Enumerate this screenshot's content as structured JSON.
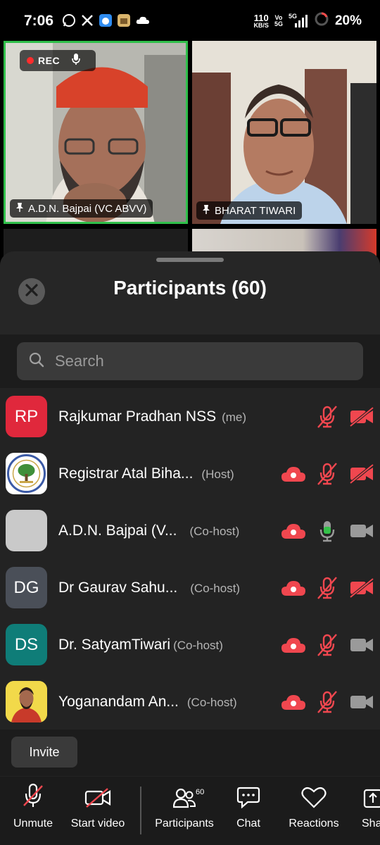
{
  "status_bar": {
    "time": "7:06",
    "net_speed_top": "110",
    "net_speed_bottom": "KB/S",
    "volte_top": "Vo",
    "volte_bottom": "5G",
    "network": "5G",
    "battery": "20%"
  },
  "video_tiles": [
    {
      "name": "A.D.N. Bajpai (VC ABVV)",
      "active_speaker": true
    },
    {
      "name": "BHARAT TIWARI",
      "active_speaker": false
    }
  ],
  "recording": {
    "label": "REC"
  },
  "sheet": {
    "title": "Participants (60)",
    "search_placeholder": "Search"
  },
  "participants": [
    {
      "initials": "RP",
      "avatar_color": "#e0283c",
      "name": "Rajkumar Pradhan NSS",
      "role": "(me)",
      "cloud": false,
      "mic": "muted",
      "video": "off"
    },
    {
      "initials": "",
      "avatar_color": "#ffffff",
      "name": "Registrar Atal Biha...",
      "role": "(Host)",
      "cloud": true,
      "mic": "muted",
      "video": "off"
    },
    {
      "initials": "",
      "avatar_color": "#c9c9c9",
      "name": "A.D.N. Bajpai (V...",
      "role": "(Co-host)",
      "cloud": true,
      "mic": "on",
      "video": "on"
    },
    {
      "initials": "DG",
      "avatar_color": "#4a4f58",
      "name": "Dr Gaurav Sahu...",
      "role": "(Co-host)",
      "cloud": true,
      "mic": "muted",
      "video": "off"
    },
    {
      "initials": "DS",
      "avatar_color": "#0f7d78",
      "name": "Dr. SatyamTiwari",
      "role": "(Co-host)",
      "cloud": true,
      "mic": "muted",
      "video": "on"
    },
    {
      "initials": "",
      "avatar_color": "#f2d94a",
      "name": "Yoganandam An...",
      "role": "(Co-host)",
      "cloud": true,
      "mic": "muted",
      "video": "on"
    }
  ],
  "invite_label": "Invite",
  "toolbar": {
    "unmute": "Unmute",
    "start_video": "Start video",
    "participants": "Participants",
    "participants_count": "60",
    "chat": "Chat",
    "reactions": "Reactions",
    "share": "Sha"
  },
  "colors": {
    "muted_red": "#f0474f",
    "mic_green": "#35c14a",
    "video_gray": "#9a9a9a",
    "speaker_border": "#2fbf4a"
  }
}
